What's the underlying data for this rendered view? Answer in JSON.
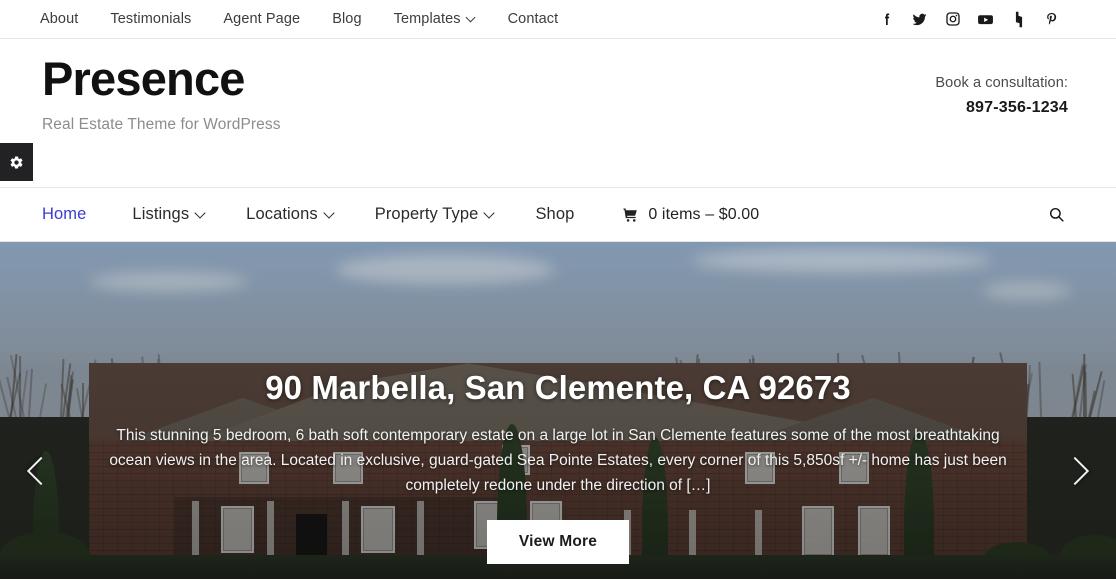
{
  "topbar": {
    "nav": [
      {
        "label": "About",
        "has_dropdown": false
      },
      {
        "label": "Testimonials",
        "has_dropdown": false
      },
      {
        "label": "Agent Page",
        "has_dropdown": false
      },
      {
        "label": "Blog",
        "has_dropdown": false
      },
      {
        "label": "Templates",
        "has_dropdown": true
      },
      {
        "label": "Contact",
        "has_dropdown": false
      }
    ],
    "social": [
      {
        "name": "facebook-icon",
        "label": "Facebook"
      },
      {
        "name": "twitter-icon",
        "label": "Twitter"
      },
      {
        "name": "instagram-icon",
        "label": "Instagram"
      },
      {
        "name": "youtube-icon",
        "label": "YouTube"
      },
      {
        "name": "houzz-icon",
        "label": "Houzz"
      },
      {
        "name": "pinterest-icon",
        "label": "Pinterest"
      }
    ]
  },
  "masthead": {
    "site_title": "Presence",
    "tagline": "Real Estate Theme for WordPress",
    "consultation_label": "Book a consultation:",
    "phone": "897-356-1234"
  },
  "settings_tab": {
    "icon": "gear-icon",
    "background": "#222224"
  },
  "mainnav": {
    "items": [
      {
        "label": "Home",
        "has_dropdown": false,
        "active": true
      },
      {
        "label": "Listings",
        "has_dropdown": true,
        "active": false
      },
      {
        "label": "Locations",
        "has_dropdown": true,
        "active": false
      },
      {
        "label": "Property Type",
        "has_dropdown": true,
        "active": false
      },
      {
        "label": "Shop",
        "has_dropdown": false,
        "active": false
      }
    ],
    "cart": {
      "icon": "shopping-cart-icon",
      "text": "0 items – $0.00"
    },
    "search": {
      "icon": "search-icon"
    },
    "active_color": "#3b3bd6"
  },
  "hero": {
    "title": "90 Marbella, San Clemente, CA 92673",
    "description": "This stunning 5 bedroom, 6 bath soft contemporary estate on a large lot in San Clemente features some of the most breathtaking ocean views in the area. Located in exclusive, guard-gated Sea Pointe Estates, every corner of this 5,850sf +/- home has just been completely redone under the direction of […]",
    "button_label": "View More",
    "prev_label": "Previous slide",
    "next_label": "Next slide"
  }
}
